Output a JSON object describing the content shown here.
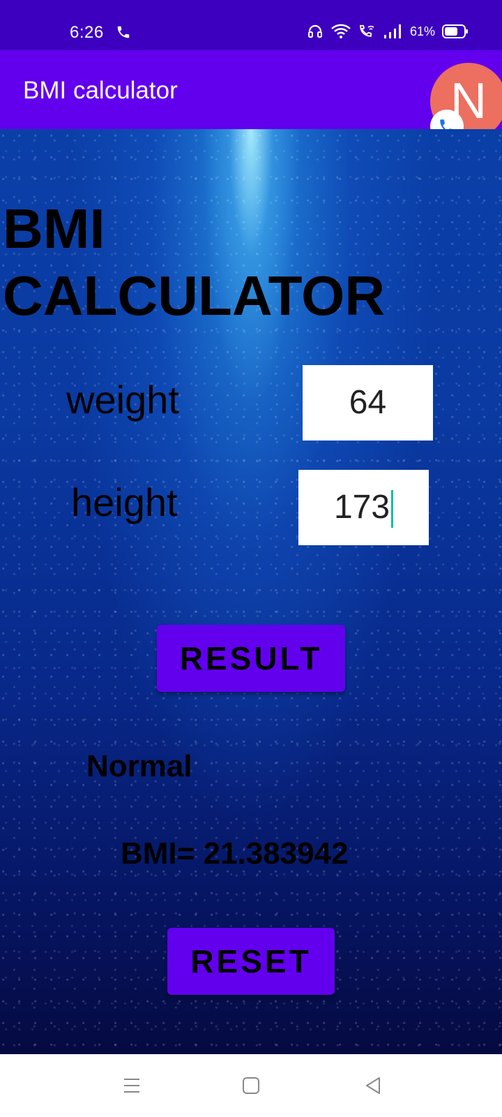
{
  "status_bar": {
    "time": "6:26",
    "battery_percent": "61%",
    "icons": [
      "call-icon",
      "headphones-icon",
      "wifi-icon",
      "wifi-calling-icon",
      "signal-icon",
      "battery-icon"
    ]
  },
  "app_bar": {
    "title": "BMI calculator",
    "avatar_letter": "N",
    "avatar_color": "#ec6f5f",
    "badge_icon": "phone-icon"
  },
  "main": {
    "heading": "BMI CALCULATOR",
    "weight_label": "weight",
    "weight_value": "64",
    "height_label": "height",
    "height_value": "173",
    "result_button": "RESULT",
    "category": "Normal",
    "bmi_text": "BMI= 21.383942",
    "reset_button": "RESET"
  },
  "nav_bar": {
    "icons": [
      "menu-icon",
      "home-icon",
      "back-icon"
    ]
  },
  "colors": {
    "status_bar": "#3d00bf",
    "app_bar": "#6200ee",
    "button": "#6200ee",
    "caret": "#00bfa5"
  }
}
